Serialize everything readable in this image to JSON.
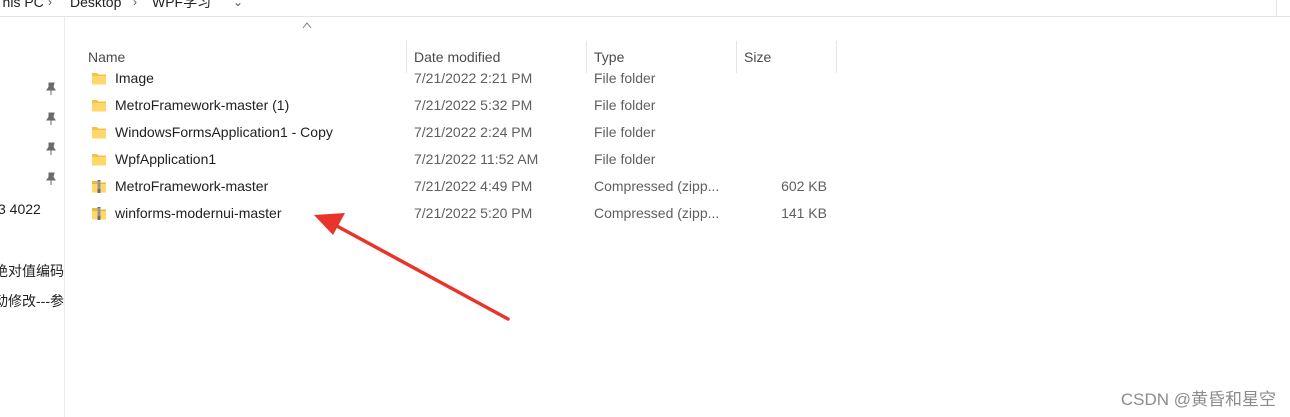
{
  "address": {
    "crumbs": [
      "This PC",
      "Desktop",
      "WPF学习"
    ],
    "separator": "›",
    "chevron": "⌄"
  },
  "nav": {
    "pins": 4,
    "text_1": "3 4022",
    "text_2": "绝对值编码",
    "text_3": "动修改---参"
  },
  "columns": {
    "name": "Name",
    "date": "Date modified",
    "type": "Type",
    "size": "Size"
  },
  "files": [
    {
      "name": "Image",
      "date": "7/21/2022 2:21 PM",
      "type": "File folder",
      "size": "",
      "icon": "folder-icon"
    },
    {
      "name": "MetroFramework-master (1)",
      "date": "7/21/2022 5:32 PM",
      "type": "File folder",
      "size": "",
      "icon": "folder-icon"
    },
    {
      "name": "WindowsFormsApplication1 - Copy",
      "date": "7/21/2022 2:24 PM",
      "type": "File folder",
      "size": "",
      "icon": "folder-icon"
    },
    {
      "name": "WpfApplication1",
      "date": "7/21/2022 11:52 AM",
      "type": "File folder",
      "size": "",
      "icon": "folder-icon"
    },
    {
      "name": "MetroFramework-master",
      "date": "7/21/2022 4:49 PM",
      "type": "Compressed (zipp...",
      "size": "602 KB",
      "icon": "zip-folder-icon"
    },
    {
      "name": "winforms-modernui-master",
      "date": "7/21/2022 5:20 PM",
      "type": "Compressed (zipp...",
      "size": "141 KB",
      "icon": "zip-folder-icon"
    }
  ],
  "annotation": {
    "color": "#e8342a",
    "icon": "red-arrow-annotation"
  },
  "watermark": "CSDN @黄昏和星空"
}
